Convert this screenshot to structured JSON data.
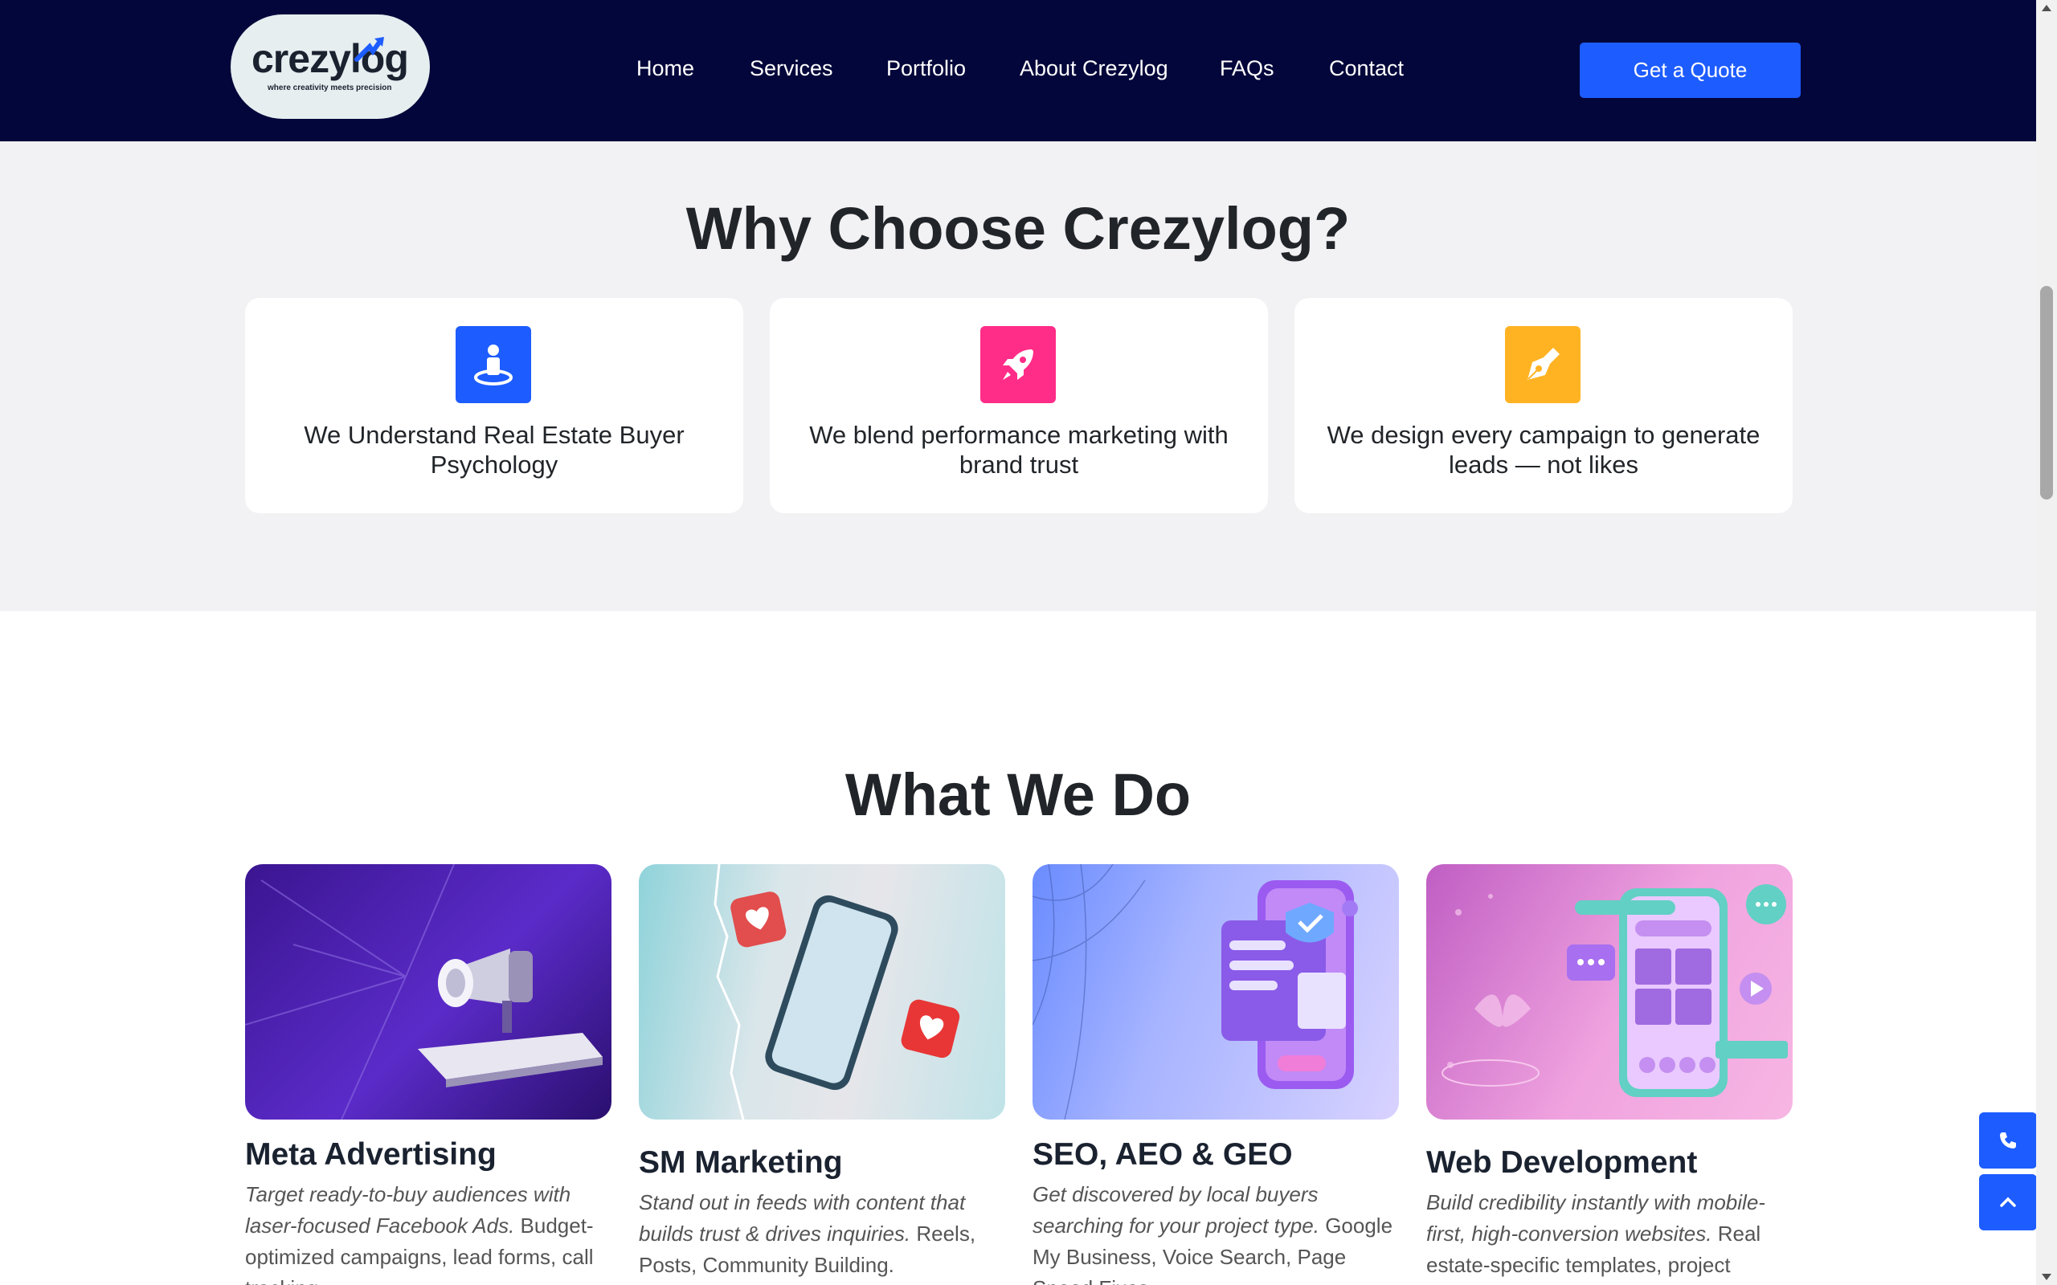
{
  "header": {
    "logo_word": "crezylog",
    "logo_tagline": "where creativity meets precision",
    "nav": [
      "Home",
      "Services",
      "Portfolio",
      "About Crezylog",
      "FAQs",
      "Contact"
    ],
    "cta": "Get a Quote",
    "bg_color": "#03063a",
    "cta_color": "#1d5cff"
  },
  "why": {
    "title": "Why Choose Crezylog?",
    "cards": [
      {
        "icon": "person-pin-icon",
        "color": "#1d5cff",
        "text": "We Understand Real Estate Buyer Psychology"
      },
      {
        "icon": "rocket-icon",
        "color": "#ff2d88",
        "text": "We blend performance marketing with brand trust"
      },
      {
        "icon": "pen-nib-icon",
        "color": "#ffb323",
        "text": "We design every campaign to generate leads — not likes"
      }
    ]
  },
  "what": {
    "title": "What We Do",
    "services": [
      {
        "title": "Meta Advertising",
        "lead": "Target ready-to-buy audiences with laser-focused Facebook Ads.",
        "rest": " Budget-optimized campaigns, lead forms, call tracking",
        "image": "megaphone-phone-image"
      },
      {
        "title": "SM Marketing",
        "lead": "Stand out in feeds with content that builds trust & drives inquiries.",
        "rest": " Reels, Posts, Community Building.",
        "image": "phone-hearts-image"
      },
      {
        "title": "SEO, AEO & GEO",
        "lead": "Get discovered by local buyers searching for your project type.",
        "rest": " Google My Business, Voice Search, Page Speed Fixes",
        "image": "secure-phone-image"
      },
      {
        "title": "Web Development",
        "lead": "Build credibility instantly with mobile-first, high-conversion websites.",
        "rest": " Real estate-specific templates, project pages",
        "image": "app-phone-image"
      }
    ]
  },
  "floating": {
    "call": "phone-icon",
    "top": "chevron-up-icon"
  }
}
